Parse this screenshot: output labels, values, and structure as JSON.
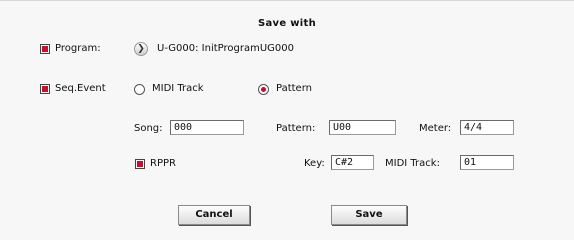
{
  "dialog": {
    "title": "Save with"
  },
  "program": {
    "checkbox_label": "Program:",
    "checked": true,
    "value": "U-G000: InitProgramUG000"
  },
  "seq_event": {
    "checkbox_label": "Seq.Event",
    "checked": true
  },
  "mode": {
    "options": [
      "MIDI Track",
      "Pattern"
    ],
    "selected": "Pattern"
  },
  "song": {
    "label": "Song:",
    "value": "000"
  },
  "pattern": {
    "label": "Pattern:",
    "value": "U00"
  },
  "meter": {
    "label": "Meter:",
    "value": "4/4"
  },
  "rppr": {
    "checkbox_label": "RPPR",
    "checked": true
  },
  "key": {
    "label": "Key:",
    "value": "C#2"
  },
  "midi_track": {
    "label": "MIDI Track:",
    "value": "01"
  },
  "buttons": {
    "cancel_label": "Cancel",
    "save_label": "Save"
  },
  "colors": {
    "accent": "#c8102e",
    "background": "#f7f7f7"
  }
}
